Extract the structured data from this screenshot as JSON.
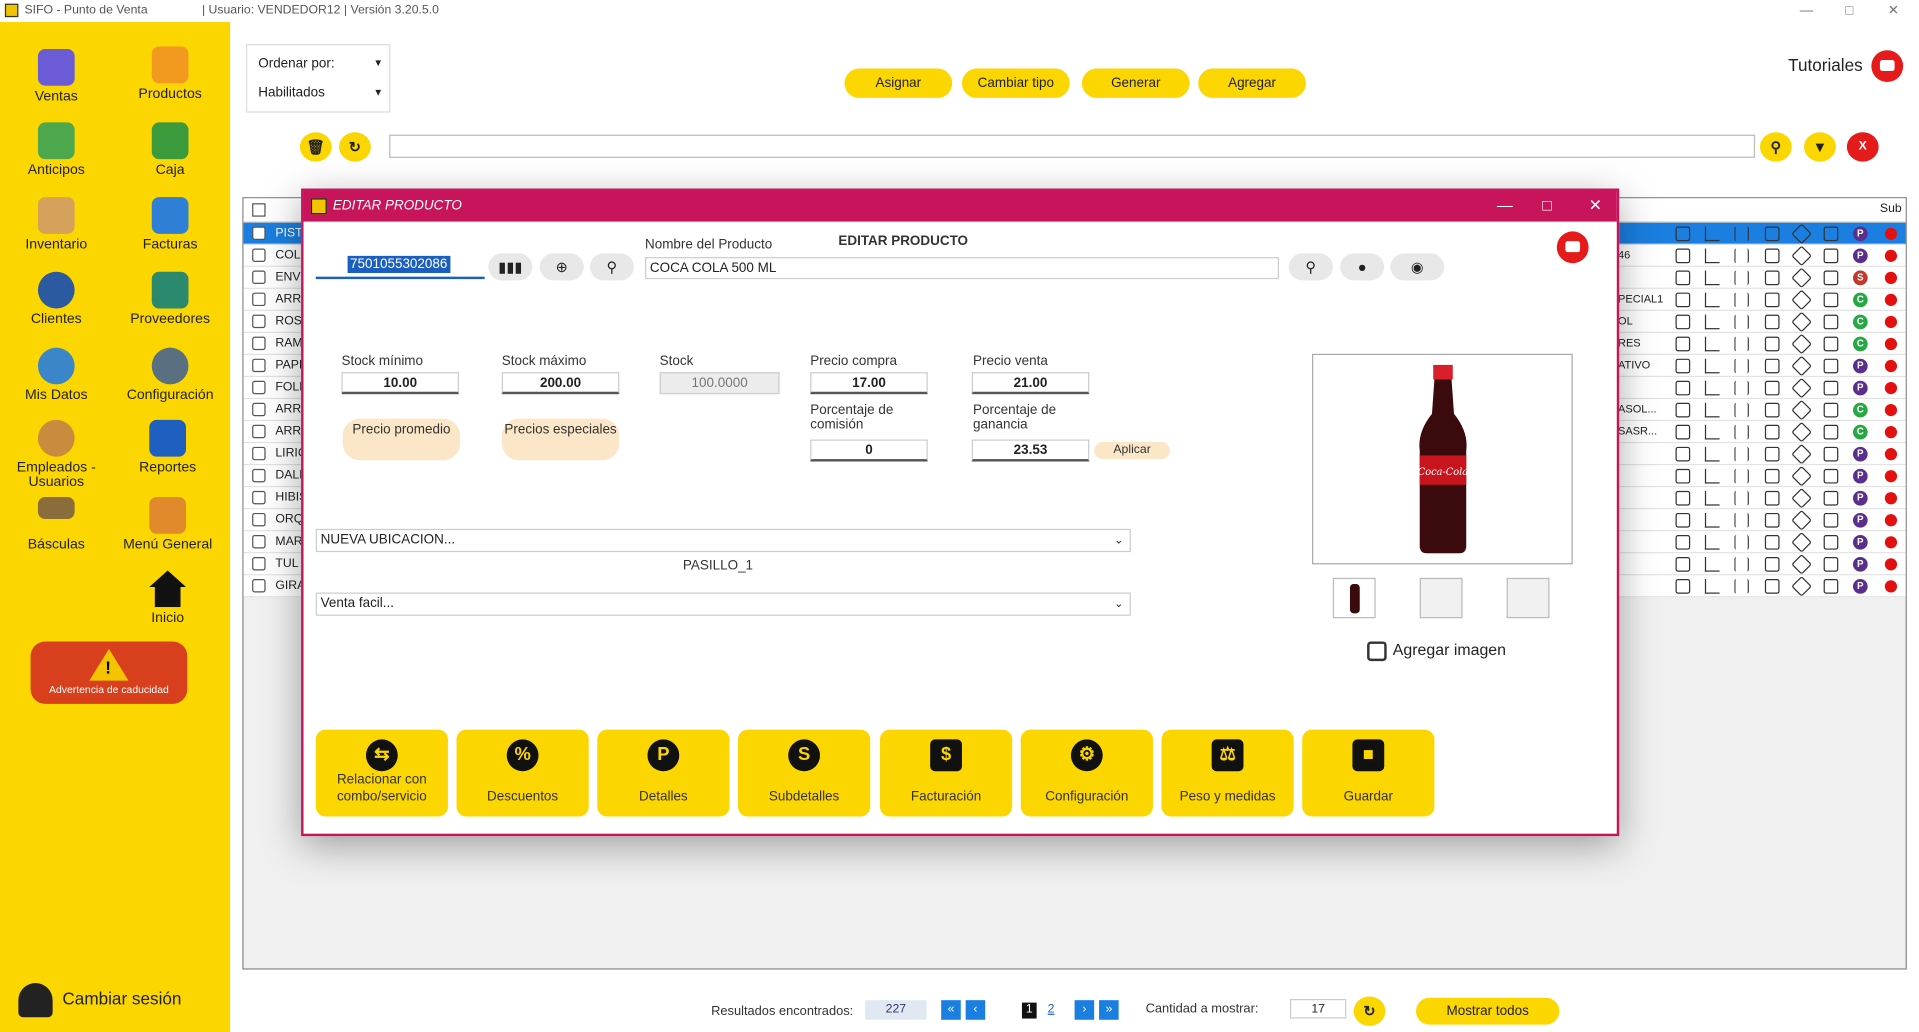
{
  "window": {
    "app_title": "SIFO - Punto de Venta",
    "user_info": "| Usuario: VENDEDOR12 | Versión 3.20.5.0"
  },
  "sidebar": {
    "items": [
      {
        "label": "Ventas",
        "icon": "cash-register-icon"
      },
      {
        "label": "Productos",
        "icon": "box-icon"
      },
      {
        "label": "Anticipos",
        "icon": "money-hand-icon"
      },
      {
        "label": "Caja",
        "icon": "cash-icon"
      },
      {
        "label": "Inventario",
        "icon": "boxes-icon"
      },
      {
        "label": "Facturas",
        "icon": "invoice-icon"
      },
      {
        "label": "Clientes",
        "icon": "client-icon"
      },
      {
        "label": "Proveedores",
        "icon": "truck-icon"
      },
      {
        "label": "Mis Datos",
        "icon": "user-icon"
      },
      {
        "label": "Configuración",
        "icon": "gear-icon"
      },
      {
        "label": "Empleados - Usuarios",
        "icon": "employees-icon"
      },
      {
        "label": "Reportes",
        "icon": "chart-icon"
      },
      {
        "label": "Básculas",
        "icon": "scale-icon"
      },
      {
        "label": "Menú General",
        "icon": "menu-icon"
      },
      {
        "label": "Inicio",
        "icon": "home-icon"
      }
    ],
    "warning": "Advertencia de caducidad",
    "switch_session": "Cambiar sesión"
  },
  "toolbar": {
    "order_by": "Ordenar por:",
    "filter": "Habilitados",
    "buttons": [
      "Asignar",
      "Cambiar tipo",
      "Generar",
      "Agregar"
    ],
    "tutorials": "Tutoriales",
    "close_label": "X"
  },
  "table": {
    "header_last": "Sub",
    "rows": [
      {
        "name": "PIST",
        "tail": "",
        "badge": "P",
        "badge_color": "#5b2d8e"
      },
      {
        "name": "COLO",
        "tail": "46",
        "badge": "P",
        "badge_color": "#5b2d8e"
      },
      {
        "name": "ENVI",
        "tail": "",
        "badge": "S",
        "badge_color": "#c0392b"
      },
      {
        "name": "ARR",
        "tail": "PECIAL1",
        "badge": "C",
        "badge_color": "#27a844"
      },
      {
        "name": "ROS",
        "tail": "OL",
        "badge": "C",
        "badge_color": "#27a844"
      },
      {
        "name": "RAM",
        "tail": "RES",
        "badge": "C",
        "badge_color": "#27a844"
      },
      {
        "name": "PAPE",
        "tail": "ATIVO",
        "badge": "P",
        "badge_color": "#5b2d8e"
      },
      {
        "name": "FOLI",
        "tail": "",
        "badge": "P",
        "badge_color": "#5b2d8e"
      },
      {
        "name": "ARR",
        "tail": "ASOL...",
        "badge": "C",
        "badge_color": "#27a844"
      },
      {
        "name": "ARR",
        "tail": "SASR...",
        "badge": "C",
        "badge_color": "#27a844"
      },
      {
        "name": "LIRIC",
        "tail": "",
        "badge": "P",
        "badge_color": "#5b2d8e"
      },
      {
        "name": "DALI",
        "tail": "",
        "badge": "P",
        "badge_color": "#5b2d8e"
      },
      {
        "name": "HIBIS",
        "tail": "",
        "badge": "P",
        "badge_color": "#5b2d8e"
      },
      {
        "name": "ORQ",
        "tail": "",
        "badge": "P",
        "badge_color": "#5b2d8e"
      },
      {
        "name": "MAR",
        "tail": "",
        "badge": "P",
        "badge_color": "#5b2d8e"
      },
      {
        "name": "TUL",
        "tail": "",
        "badge": "P",
        "badge_color": "#5b2d8e"
      },
      {
        "name": "GIRA",
        "tail": "",
        "badge": "P",
        "badge_color": "#5b2d8e"
      }
    ]
  },
  "pagination": {
    "results_label": "Resultados encontrados:",
    "results": "227",
    "page1": "1",
    "page2": "2",
    "qty_label": "Cantidad a mostrar:",
    "qty": "17",
    "show_all": "Mostrar todos"
  },
  "modal": {
    "title": "EDITAR PRODUCTO",
    "heading": "EDITAR PRODUCTO",
    "barcode": "7501055302086",
    "name_label": "Nombre del Producto",
    "name": "COCA COLA 500 ML",
    "stock_min_label": "Stock mínimo",
    "stock_min": "10.00",
    "stock_max_label": "Stock máximo",
    "stock_max": "200.00",
    "stock_label": "Stock",
    "stock": "100.0000",
    "buy_label": "Precio compra",
    "buy": "17.00",
    "sell_label": "Precio venta",
    "sell": "21.00",
    "commission_label": "Porcentaje de comisión",
    "commission": "0",
    "gain_label": "Porcentaje de ganancia",
    "gain": "23.53",
    "apply": "Aplicar",
    "avg_price": "Precio promedio",
    "special_prices": "Precios especiales",
    "location": "NUEVA UBICACION...",
    "location_value": "PASILLO_1",
    "sale_type": "Venta facil...",
    "add_image": "Agregar imagen",
    "bottle_text": "Coca-Cola",
    "actions": [
      {
        "label": "Relacionar con combo/servicio",
        "icon": "combo-icon"
      },
      {
        "label": "Descuentos",
        "icon": "discount-icon"
      },
      {
        "label": "Detalles",
        "icon": "details-p-icon"
      },
      {
        "label": "Subdetalles",
        "icon": "subdetails-s-icon"
      },
      {
        "label": "Facturación",
        "icon": "invoice-icon"
      },
      {
        "label": "Configuración",
        "icon": "gear-icon"
      },
      {
        "label": "Peso y medidas",
        "icon": "weight-icon"
      },
      {
        "label": "Guardar",
        "icon": "save-icon"
      }
    ]
  }
}
